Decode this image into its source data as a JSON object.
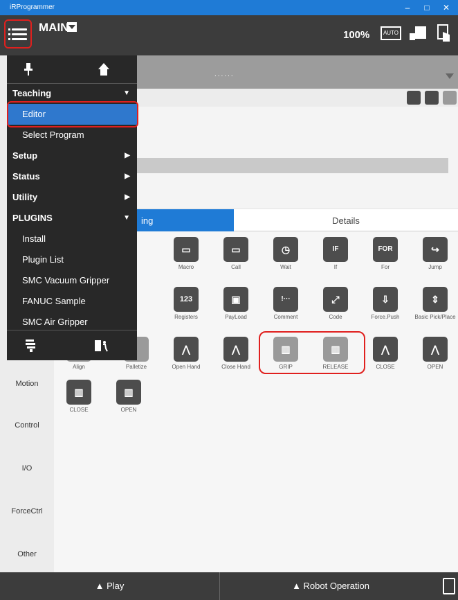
{
  "window": {
    "title": "iRProgrammer",
    "min": "–",
    "max": "□",
    "close": "✕"
  },
  "header": {
    "program": "MAIN",
    "zoom": "100%",
    "auto_badge": "AUTO"
  },
  "strip": {
    "dots": "......"
  },
  "tabs": [
    {
      "label": "ing"
    },
    {
      "label": "Details"
    }
  ],
  "categories": [
    "Motion",
    "Control",
    "I/O",
    "ForceCtrl",
    "Other"
  ],
  "menu": {
    "items": [
      {
        "label": "Teaching",
        "type": "head",
        "arrow": "▼"
      },
      {
        "label": "Editor",
        "type": "sub",
        "selected": true
      },
      {
        "label": "Select Program",
        "type": "sub"
      },
      {
        "label": "Setup",
        "type": "head",
        "arrow": "▶"
      },
      {
        "label": "Status",
        "type": "head",
        "arrow": "▶"
      },
      {
        "label": "Utility",
        "type": "head",
        "arrow": "▶"
      },
      {
        "label": "PLUGINS",
        "type": "head",
        "arrow": "▼"
      },
      {
        "label": "Install",
        "type": "sub"
      },
      {
        "label": "Plugin List",
        "type": "sub"
      },
      {
        "label": "SMC Vacuum Gripper",
        "type": "sub"
      },
      {
        "label": "FANUC Sample",
        "type": "sub"
      },
      {
        "label": "SMC Air Gripper",
        "type": "sub"
      }
    ]
  },
  "palette": {
    "row1": [
      "Macro",
      "Call",
      "Wait",
      "If",
      "For",
      "Jump"
    ],
    "row2": [
      "t",
      "Registers",
      "PayLoad",
      "Comment",
      "Code",
      "Force.Push",
      "Basic Pick/Place"
    ],
    "row3": [
      "Align",
      "Palletize",
      "Open Hand",
      "Close Hand",
      "GRIP",
      "RELEASE",
      "CLOSE",
      "OPEN"
    ],
    "row4": [
      "CLOSE",
      "OPEN"
    ],
    "glyphs": {
      "for": "FOR",
      "if": "IF",
      "registers": "123",
      "comment": "!···"
    }
  },
  "bottom": {
    "play": "▲ Play",
    "robot": "▲ Robot Operation"
  },
  "colors": {
    "accent": "#1f7bd6",
    "header": "#3c3c3c",
    "highlight": "#e0201e"
  }
}
